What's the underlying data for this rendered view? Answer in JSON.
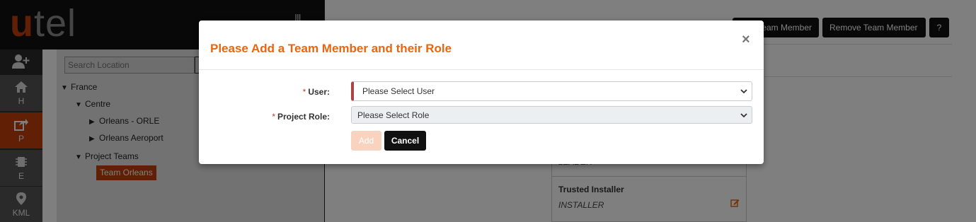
{
  "app": {
    "logo_u": "u",
    "logo_rest": "tel",
    "accent_color": "#c2410c",
    "title_color": "#e8660f"
  },
  "nav": {
    "add_user_icon": "add-user-icon",
    "items": [
      {
        "label": "H",
        "icon": "home-icon"
      },
      {
        "label": "P",
        "icon": "share-icon"
      },
      {
        "label": "E",
        "icon": "chip-icon"
      },
      {
        "label": "KML",
        "icon": "map-pin-icon"
      }
    ]
  },
  "tree": {
    "search_placeholder": "Search Location",
    "nodes": [
      {
        "label": "France"
      },
      {
        "label": "Centre"
      },
      {
        "label": "Orleans - ORLE"
      },
      {
        "label": "Orleans Aeroport"
      },
      {
        "label": "Project Teams"
      }
    ],
    "selected_team": "Team Orleans"
  },
  "toolbar": {
    "add_member": "Add Team Member",
    "remove_member": "Remove Team Member",
    "help": "?"
  },
  "card": {
    "above_text": "LEADER",
    "title": "Trusted Installer",
    "role": "INSTALLER"
  },
  "modal": {
    "title": "Please Add a Team Member and their Role",
    "close": "×",
    "required_marker": "*",
    "user_label": "User:",
    "user_value": "Please Select User",
    "role_label": "Project Role:",
    "role_value": "Please Select Role",
    "add_label": "Add",
    "cancel_label": "Cancel"
  }
}
